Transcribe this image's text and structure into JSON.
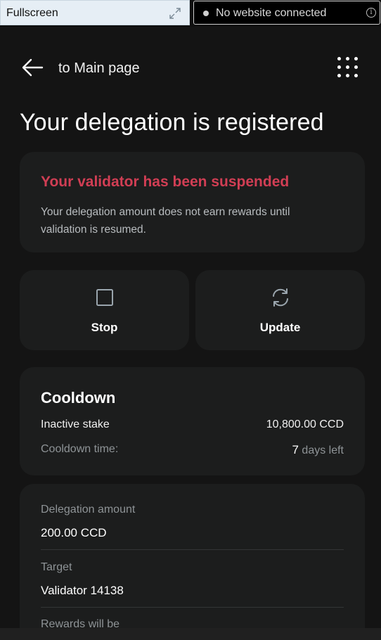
{
  "browser": {
    "fullscreen_label": "Fullscreen",
    "connection_label": "No website connected",
    "info_glyph": "i"
  },
  "header": {
    "back_label": "to Main page",
    "title": "Your delegation is registered"
  },
  "alert": {
    "title": "Your validator has been suspended",
    "body": "Your delegation amount does not earn rewards until validation is resumed.",
    "color": "#d13e54"
  },
  "actions": {
    "stop_label": "Stop",
    "update_label": "Update"
  },
  "cooldown": {
    "title": "Cooldown",
    "inactive_label": "Inactive stake",
    "inactive_value": "10,800.00 CCD",
    "time_label": "Cooldown time:",
    "days_number": "7",
    "days_suffix": " days left"
  },
  "delegation": {
    "amount_label": "Delegation amount",
    "amount_value": "200.00 CCD",
    "target_label": "Target",
    "target_value": "Validator 14138",
    "rewards_label": "Rewards will be"
  },
  "icons": {
    "fullscreen": "expand-icon",
    "back": "arrow-left-icon",
    "menu": "grid-menu-icon",
    "stop": "square-icon",
    "update": "refresh-icon",
    "info": "info-icon"
  }
}
